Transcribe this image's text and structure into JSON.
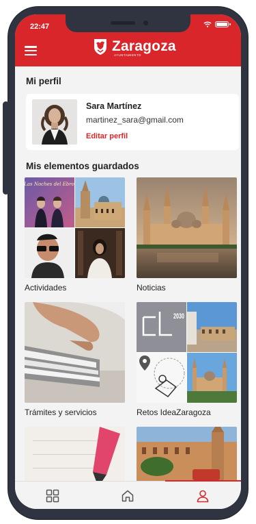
{
  "status_bar": {
    "time": "22:47"
  },
  "header": {
    "brand_name": "Zaragoza",
    "brand_sub": "AYUNTAMIENTO"
  },
  "profile": {
    "section_title": "Mi perfil",
    "name": "Sara Martínez",
    "email": "martinez_sara@gmail.com",
    "edit_label": "Editar perfil"
  },
  "saved": {
    "section_title": "Mis elementos guardados",
    "items": [
      {
        "label": "Actividades"
      },
      {
        "label": "Noticias"
      },
      {
        "label": "Trámites y servicios"
      },
      {
        "label": "Retos IdeaZaragoza"
      }
    ],
    "poster_text": "Las Noches del Ebro",
    "retos_number": "2030"
  },
  "tabbar": {
    "items": [
      "grid-icon",
      "home-icon",
      "user-icon"
    ],
    "active": "user-icon"
  },
  "colors": {
    "accent": "#d8262b",
    "background": "#f3f3f3",
    "frame": "#2f3440"
  }
}
